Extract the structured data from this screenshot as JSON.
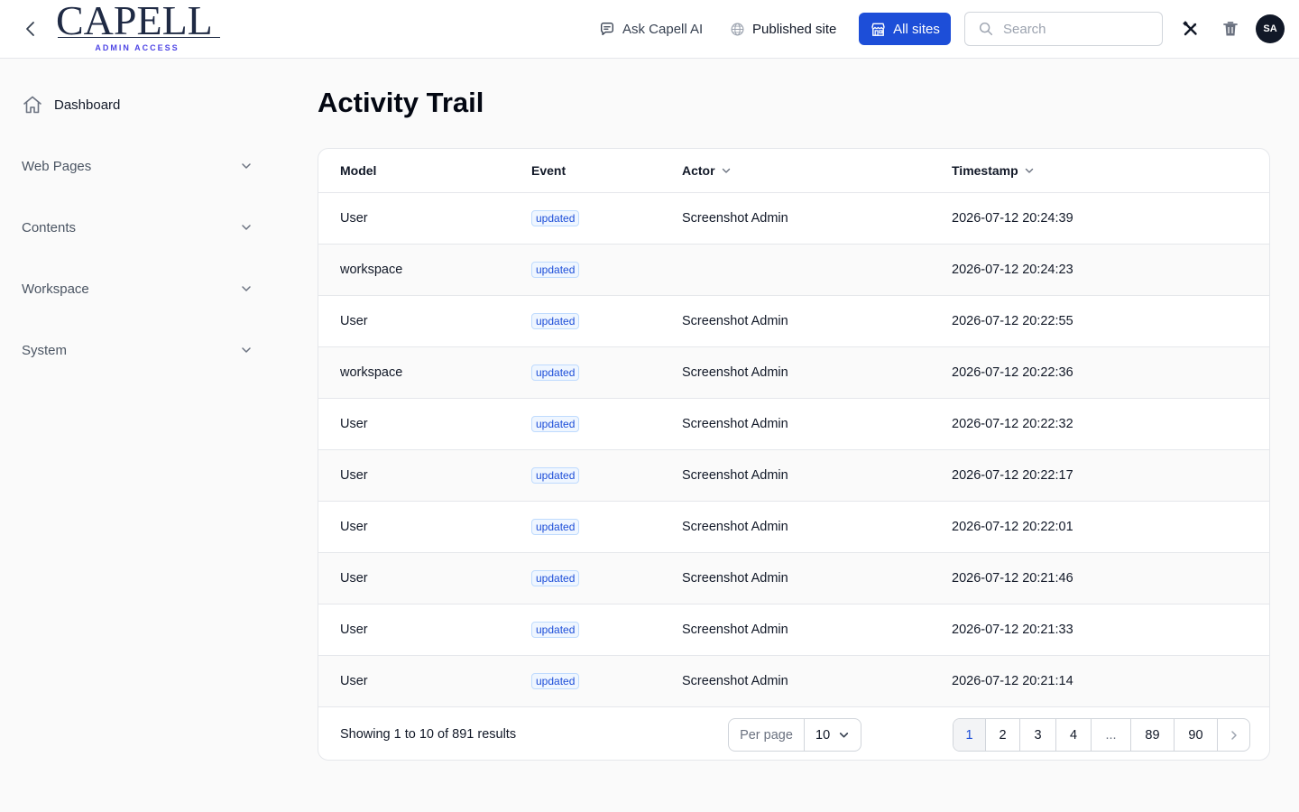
{
  "brand": {
    "name": "CAPELL",
    "subtitle": "ADMIN ACCESS"
  },
  "header": {
    "ask_ai_label": "Ask Capell AI",
    "published_label": "Published site",
    "all_sites_label": "All sites",
    "search_placeholder": "Search",
    "avatar_initials": "SA"
  },
  "sidebar": {
    "dashboard_label": "Dashboard",
    "groups": [
      {
        "label": "Web Pages"
      },
      {
        "label": "Contents"
      },
      {
        "label": "Workspace"
      },
      {
        "label": "System"
      }
    ]
  },
  "page": {
    "title": "Activity Trail"
  },
  "table": {
    "columns": [
      "Model",
      "Event",
      "Actor",
      "Timestamp"
    ],
    "rows": [
      {
        "model": "User",
        "event": "updated",
        "actor": "Screenshot Admin",
        "timestamp": "2026-07-12 20:24:39"
      },
      {
        "model": "workspace",
        "event": "updated",
        "actor": "",
        "timestamp": "2026-07-12 20:24:23"
      },
      {
        "model": "User",
        "event": "updated",
        "actor": "Screenshot Admin",
        "timestamp": "2026-07-12 20:22:55"
      },
      {
        "model": "workspace",
        "event": "updated",
        "actor": "Screenshot Admin",
        "timestamp": "2026-07-12 20:22:36"
      },
      {
        "model": "User",
        "event": "updated",
        "actor": "Screenshot Admin",
        "timestamp": "2026-07-12 20:22:32"
      },
      {
        "model": "User",
        "event": "updated",
        "actor": "Screenshot Admin",
        "timestamp": "2026-07-12 20:22:17"
      },
      {
        "model": "User",
        "event": "updated",
        "actor": "Screenshot Admin",
        "timestamp": "2026-07-12 20:22:01"
      },
      {
        "model": "User",
        "event": "updated",
        "actor": "Screenshot Admin",
        "timestamp": "2026-07-12 20:21:46"
      },
      {
        "model": "User",
        "event": "updated",
        "actor": "Screenshot Admin",
        "timestamp": "2026-07-12 20:21:33"
      },
      {
        "model": "User",
        "event": "updated",
        "actor": "Screenshot Admin",
        "timestamp": "2026-07-12 20:21:14"
      }
    ]
  },
  "footer": {
    "results_text": "Showing 1 to 10 of 891 results",
    "per_page_label": "Per page",
    "per_page_value": "10",
    "pages": [
      "1",
      "2",
      "3",
      "4",
      "...",
      "89",
      "90"
    ],
    "active_page": "1"
  },
  "colors": {
    "accent": "#1d4ed8",
    "brand_navy": "#1f2a44",
    "brand_indigo": "#4f46e5"
  }
}
